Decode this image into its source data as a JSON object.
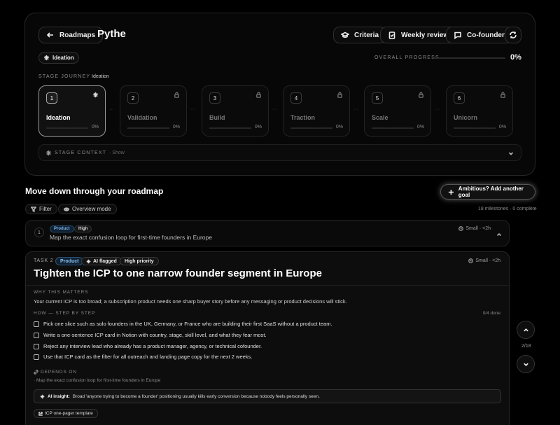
{
  "header": {
    "back_label": "Roadmaps",
    "title": "Pythe",
    "criteria_label": "Criteria",
    "weekly_label": "Weekly review",
    "cofounder_label": "Co-founder"
  },
  "stage_chip": "Ideation",
  "overall": {
    "label": "OVERALL PROGRESS",
    "percent_text": "0%",
    "progress": 0
  },
  "journey": {
    "label": "STAGE JOURNEY",
    "current": "Ideation",
    "stages": [
      {
        "num": "1",
        "name": "Ideation",
        "pct": "0%"
      },
      {
        "num": "2",
        "name": "Validation",
        "pct": "0%"
      },
      {
        "num": "3",
        "name": "Build",
        "pct": "0%"
      },
      {
        "num": "4",
        "name": "Traction",
        "pct": "0%"
      },
      {
        "num": "5",
        "name": "Scale",
        "pct": "0%"
      },
      {
        "num": "6",
        "name": "Unicorn",
        "pct": "0%"
      }
    ]
  },
  "context": {
    "label": "STAGE CONTEXT",
    "show": "· Show"
  },
  "roadmap": {
    "title": "Move down through your roadmap",
    "add_goal": "Ambitious? Add another goal",
    "filter": "Filter",
    "overview": "Overview mode",
    "milestones": "18 milestones · 0 complete"
  },
  "task1": {
    "num": "1",
    "tag_category": "Product",
    "tag_priority": "High",
    "title": "Map the exact confusion loop for first-time founders in Europe",
    "meta": "Small · <2h"
  },
  "task2": {
    "label": "TASK 2",
    "tag_category": "Product",
    "tag_ai": "AI flagged",
    "tag_priority": "High priority",
    "meta": "Small · <2h",
    "title": "Tighten the ICP to one narrow founder segment in Europe",
    "why_heading": "WHY THIS MATTERS",
    "why_text": "Your current ICP is too broad; a subscription product needs one sharp buyer story before any messaging or product decisions will stick.",
    "how_heading": "HOW — STEP BY STEP",
    "done": "0/4 done",
    "steps": [
      "Pick one slice such as solo founders in the UK, Germany, or France who are building their first SaaS without a product team.",
      "Write a one-sentence ICP card in Notion with country, stage, skill level, and what they fear most.",
      "Reject any interview lead who already has a product manager, agency, or technical cofounder.",
      "Use that ICP card as the filter for all outreach and landing page copy for the next 2 weeks."
    ],
    "depends_heading": "DEPENDS ON",
    "depends_item": "· Map the exact confusion loop for first-time founders in Europe",
    "insight_label": "AI insight:",
    "insight_text": "Broad 'anyone trying to become a founder' positioning usually kills early conversion because nobody feels personally seen.",
    "resource": "ICP one-pager template"
  },
  "nav": {
    "counter": "2/18"
  }
}
